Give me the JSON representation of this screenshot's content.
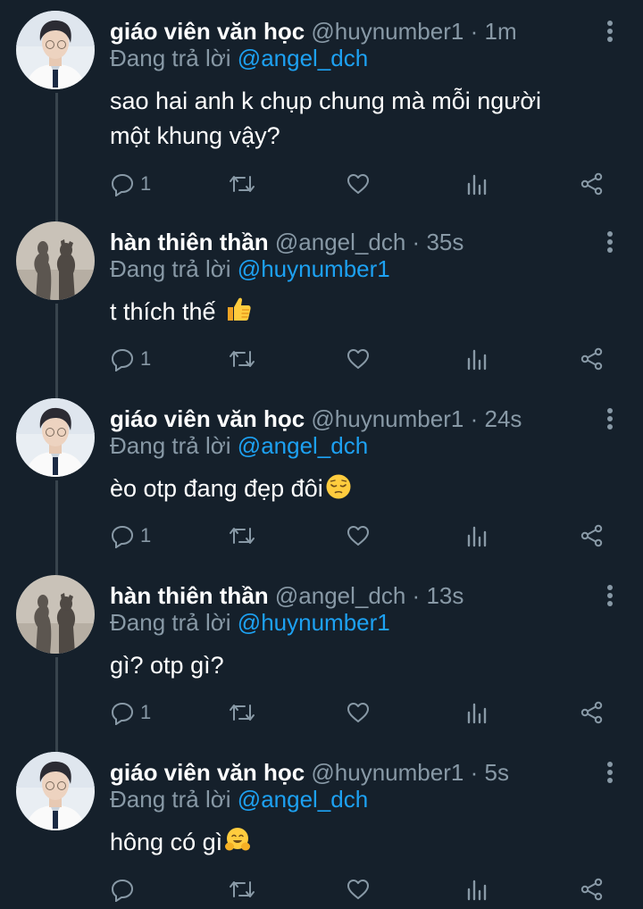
{
  "users": {
    "teacher": {
      "display_name": "giáo viên văn học",
      "handle": "@huynumber1"
    },
    "angel": {
      "display_name": "hàn thiên thần",
      "handle": "@angel_dch"
    }
  },
  "separator": "·",
  "reply_prefix": "Đang trả lời",
  "tweets": [
    {
      "author_name": "giáo viên văn học",
      "handle": "@huynumber1",
      "time": "1m",
      "reply_to": "@angel_dch",
      "text": "sao hai anh k chụp chung mà mỗi người một khung vậy?",
      "emoji": "",
      "reply_count": "1"
    },
    {
      "author_name": "hàn thiên thần",
      "handle": "@angel_dch",
      "time": "35s",
      "reply_to": "@huynumber1",
      "text": "t thích thế",
      "emoji": "thumbs-up",
      "reply_count": "1"
    },
    {
      "author_name": "giáo viên văn học",
      "handle": "@huynumber1",
      "time": "24s",
      "reply_to": "@angel_dch",
      "text": "èo otp đang đẹp đôi",
      "emoji": "pensive-face",
      "reply_count": "1"
    },
    {
      "author_name": "hàn thiên thần",
      "handle": "@angel_dch",
      "time": "13s",
      "reply_to": "@huynumber1",
      "text": "gì? otp gì?",
      "emoji": "",
      "reply_count": "1"
    },
    {
      "author_name": "giáo viên văn học",
      "handle": "@huynumber1",
      "time": "5s",
      "reply_to": "@angel_dch",
      "text": "hông có gì",
      "emoji": "hugging-face",
      "reply_count": ""
    }
  ],
  "icons": [
    "reply-icon",
    "retweet-icon",
    "like-icon",
    "analytics-icon",
    "share-icon",
    "more-icon"
  ],
  "colors": {
    "background": "#15202b",
    "text": "#ffffff",
    "muted": "#8899a6",
    "link": "#1da1f2",
    "thread_line": "#38444d"
  }
}
